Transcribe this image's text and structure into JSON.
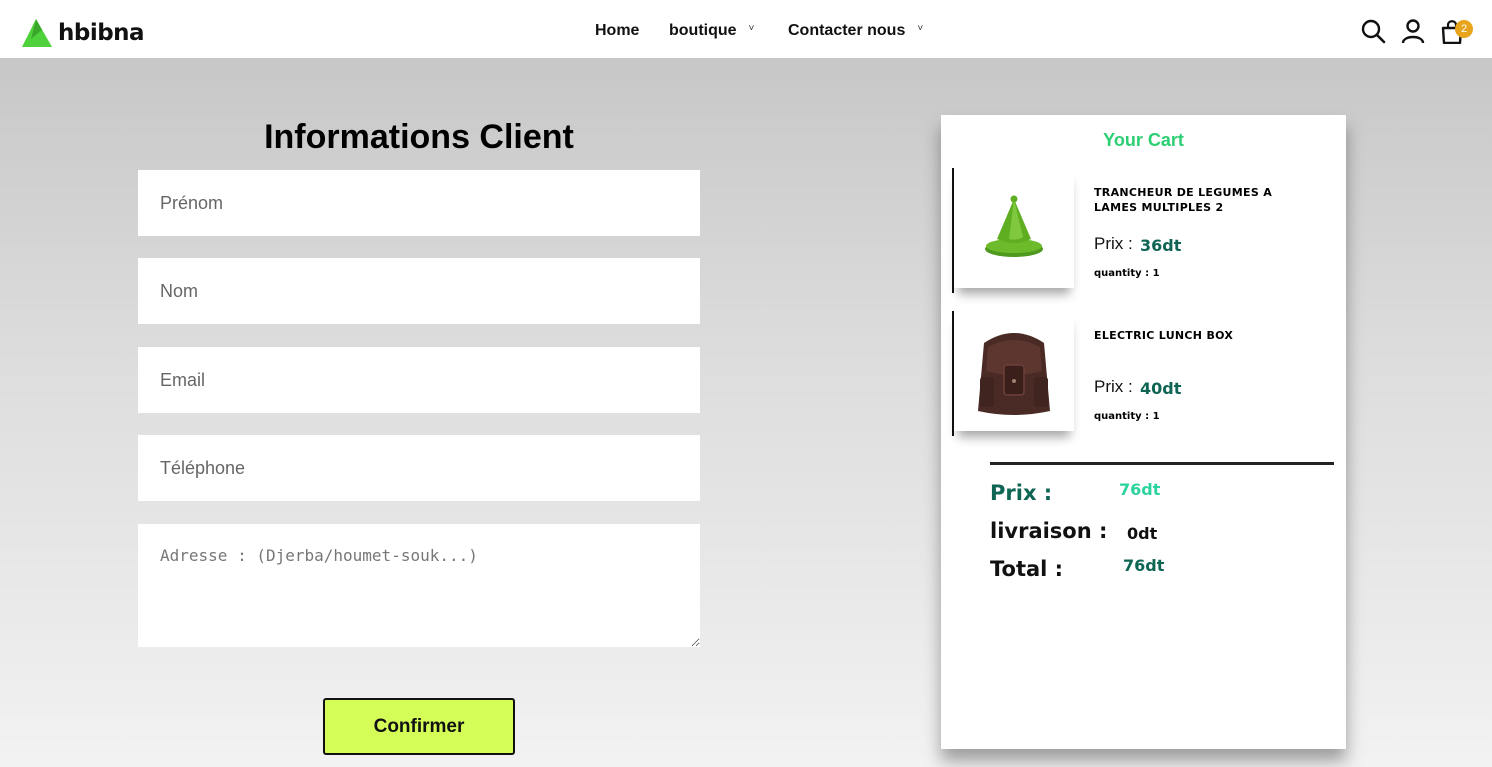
{
  "header": {
    "logo_text": "hbibna",
    "nav": [
      {
        "label": "Home",
        "has_dropdown": false
      },
      {
        "label": "boutique",
        "has_dropdown": true
      },
      {
        "label": "Contacter nous",
        "has_dropdown": true
      }
    ],
    "icons": [
      "search-icon",
      "user-icon",
      "shopping-bag-icon"
    ],
    "cart_count": "2",
    "chevron": "˅"
  },
  "form": {
    "title": "Informations Client",
    "fields": {
      "prenom": {
        "placeholder": "Prénom",
        "value": ""
      },
      "nom": {
        "placeholder": "Nom",
        "value": ""
      },
      "email": {
        "placeholder": "Email",
        "value": ""
      },
      "telephone": {
        "placeholder": "Téléphone",
        "value": ""
      },
      "adresse": {
        "placeholder": "Adresse : (Djerba/houmet-souk...)",
        "value": ""
      }
    },
    "confirm_label": "Confirmer"
  },
  "cart": {
    "title": "Your Cart",
    "items": [
      {
        "name": "TRANCHEUR DE LEGUMES A LAMES MULTIPLES 2",
        "price_label": "Prix :",
        "price": "36dt",
        "quantity": "quantity : 1",
        "image": "green-tagine-image"
      },
      {
        "name": "ELECTRIC LUNCH BOX",
        "price_label": "Prix :",
        "price": "40dt",
        "quantity": "quantity : 1",
        "image": "leather-backpack-image"
      }
    ],
    "summary": {
      "prix_label": "Prix :",
      "prix_value": "76dt",
      "livraison_label": "livraison :",
      "livraison_value": "0dt",
      "total_label": "Total :",
      "total_value": "76dt"
    }
  },
  "colors": {
    "accent_green": "#2dcf73",
    "price_green": "#0e6554",
    "confirm_bg": "#d4fd58",
    "badge": "#e8a41b"
  }
}
